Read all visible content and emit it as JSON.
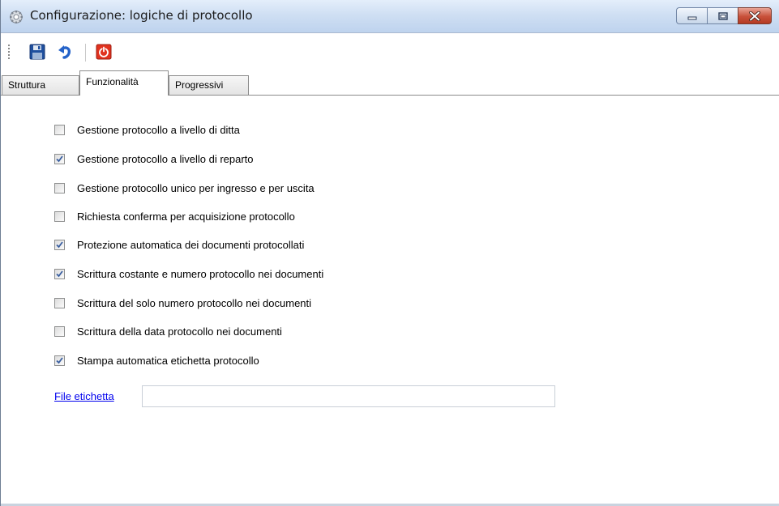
{
  "window": {
    "title": "Configurazione: logiche di protocollo",
    "icon": "gear-icon"
  },
  "toolbar": {
    "items": [
      {
        "name": "save",
        "icon": "floppy-disk-icon"
      },
      {
        "name": "undo",
        "icon": "undo-arrow-icon"
      },
      {
        "name": "exit",
        "icon": "power-icon"
      }
    ]
  },
  "tabs": [
    {
      "label": "Struttura",
      "active": false
    },
    {
      "label": "Funzionalità",
      "active": true
    },
    {
      "label": "Progressivi",
      "active": false
    }
  ],
  "options": [
    {
      "label": "Gestione protocollo a livello di ditta",
      "checked": false
    },
    {
      "label": "Gestione protocollo a livello di reparto",
      "checked": true
    },
    {
      "label": "Gestione protocollo unico per ingresso e per uscita",
      "checked": false
    },
    {
      "label": "Richiesta conferma per acquisizione protocollo",
      "checked": false
    },
    {
      "label": "Protezione automatica dei documenti protocollati",
      "checked": true
    },
    {
      "label": "Scrittura costante e numero protocollo nei documenti",
      "checked": true
    },
    {
      "label": "Scrittura del solo numero protocollo nei documenti",
      "checked": false
    },
    {
      "label": "Scrittura della data protocollo nei documenti",
      "checked": false
    },
    {
      "label": "Stampa automatica etichetta protocollo",
      "checked": true
    }
  ],
  "file_etichetta": {
    "label": "File etichetta",
    "value": ""
  },
  "colors": {
    "link": "#0000ee",
    "check": "#3a5fa0"
  }
}
